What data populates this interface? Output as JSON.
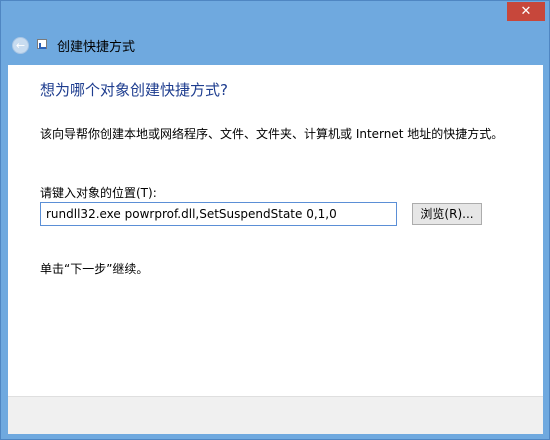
{
  "window": {
    "title": "创建快捷方式",
    "close_glyph": "✕",
    "back_glyph": "←"
  },
  "content": {
    "heading": "想为哪个对象创建快捷方式?",
    "description": "该向导帮你创建本地或网络程序、文件、文件夹、计算机或 Internet 地址的快捷方式。",
    "field_label": "请键入对象的位置(T):",
    "field_value": "rundll32.exe powrprof.dll,SetSuspendState 0,1,0",
    "browse_label": "浏览(R)...",
    "hint": "单击“下一步”继续。"
  },
  "colors": {
    "frame": "#6fa9df",
    "close": "#c7473b",
    "heading": "#1e3d8f",
    "input_border": "#5b8fd6"
  }
}
